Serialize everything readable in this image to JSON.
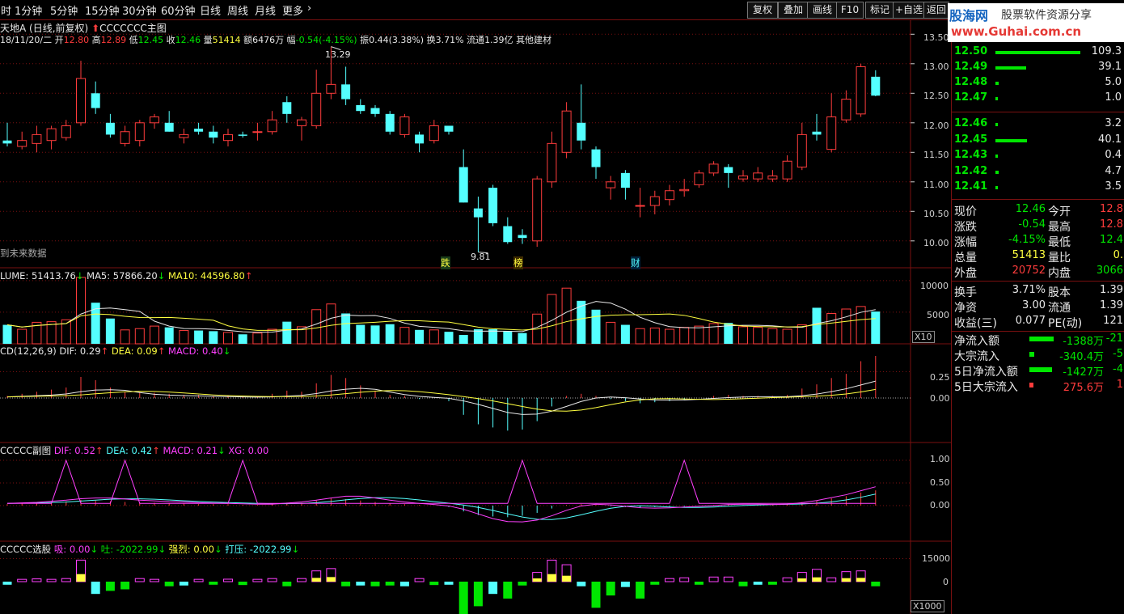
{
  "toolbar": {
    "periods": [
      "时",
      "1分钟",
      "5分钟",
      "15分钟",
      "30分钟",
      "60分钟",
      "日线",
      "周线",
      "月线",
      "更多"
    ],
    "more_arrow": "›",
    "buttons": [
      "复权",
      "叠加",
      "画线",
      "F10",
      "标记",
      "+自选",
      "返回"
    ]
  },
  "logo": {
    "brand": "股海网",
    "slogan": "股票软件资源分享",
    "url": "www.Guhai.com.cn"
  },
  "main": {
    "stock": "天地A",
    "mode": "(日线,前复权)",
    "title": "CCCCCCC主图",
    "date": "18/11/20/二",
    "open_label": "开",
    "open": "12.80",
    "high_label": "高",
    "high": "12.89",
    "low_label": "低",
    "low": "12.45",
    "close_label": "收",
    "close": "12.46",
    "vol_label": "量",
    "vol": "51414",
    "amount_label": "额",
    "amount": "6476万",
    "change_label": "幅",
    "change": "-0.54(-4.15%)",
    "amp_label": "振",
    "amp": "0.44(3.38%)",
    "turn_label": "换",
    "turn": "3.71%",
    "float_label": "流通",
    "float": "1.39亿",
    "sector": "其他建材",
    "future_text": "到未来数据",
    "high_mark": "13.29",
    "low_mark": "9.81",
    "tags": [
      "跌",
      "榜",
      "财"
    ],
    "axis": [
      "13.50",
      "13.00",
      "12.50",
      "12.00",
      "11.50",
      "11.00",
      "10.50",
      "10.00"
    ]
  },
  "volume": {
    "label": "LUME: 51413.76",
    "ma5": "MA5: 57866.20",
    "ma10": "MA10: 44596.80",
    "axis": [
      "10000",
      "5000"
    ],
    "unit": "X10"
  },
  "macd": {
    "label": "CD(12,26,9)",
    "dif": "DIF: 0.29",
    "dea": "DEA: 0.09",
    "macd": "MACD: 0.40",
    "axis": [
      "0.25",
      "0.00"
    ]
  },
  "sub": {
    "label": "CCCCC副图",
    "dif": "DIF: 0.52",
    "dea": "DEA: 0.42",
    "macd": "MACD: 0.21",
    "xg": "XG: 0.00",
    "axis": [
      "1.00",
      "0.50",
      "0.00"
    ]
  },
  "select": {
    "label": "CCCCC选股",
    "xi": "吸: 0.00",
    "tu": "吐: -2022.99",
    "qiang": "强烈: 0.00",
    "daya": "打压: -2022.99",
    "axis": [
      "15000",
      "0"
    ],
    "unit": "X1000"
  },
  "orderbook": {
    "sell": [
      {
        "price": "12.50",
        "vol": "109.3",
        "bar": 100
      },
      {
        "price": "12.49",
        "vol": "39.1",
        "bar": 36
      },
      {
        "price": "12.48",
        "vol": "5.0",
        "bar": 4
      },
      {
        "price": "12.47",
        "vol": "1.0",
        "bar": 2
      }
    ],
    "buy": [
      {
        "price": "12.46",
        "vol": "3.2",
        "bar": 3
      },
      {
        "price": "12.45",
        "vol": "40.1",
        "bar": 37
      },
      {
        "price": "12.43",
        "vol": "0.4",
        "bar": 1
      },
      {
        "price": "12.42",
        "vol": "4.7",
        "bar": 4
      },
      {
        "price": "12.41",
        "vol": "3.5",
        "bar": 3
      }
    ]
  },
  "quote": [
    {
      "k1": "现价",
      "v1": "12.46",
      "c1": "grn",
      "k2": "今开",
      "v2": "12.8",
      "c2": "red"
    },
    {
      "k1": "涨跌",
      "v1": "-0.54",
      "c1": "grn",
      "k2": "最高",
      "v2": "12.8",
      "c2": "red"
    },
    {
      "k1": "涨幅",
      "v1": "-4.15%",
      "c1": "grn",
      "k2": "最低",
      "v2": "12.4",
      "c2": "grn"
    },
    {
      "k1": "总量",
      "v1": "51413",
      "c1": "yel",
      "k2": "量比",
      "v2": "0.",
      "c2": "yel"
    },
    {
      "k1": "外盘",
      "v1": "20752",
      "c1": "red",
      "k2": "内盘",
      "v2": "3066",
      "c2": "grn"
    }
  ],
  "fund": [
    {
      "k1": "换手",
      "v1": "3.71%",
      "k2": "股本",
      "v2": "1.39"
    },
    {
      "k1": "净资",
      "v1": "3.00",
      "k2": "流通",
      "v2": "1.39"
    },
    {
      "k1": "收益(三)",
      "v1": "0.077",
      "k2": "PE(动)",
      "v2": "121"
    }
  ],
  "flow": [
    {
      "k": "净流入额",
      "v": "-1388万",
      "v2": "-21",
      "bar": 30,
      "color": "#00e600",
      "vcolor": "grn"
    },
    {
      "k": "大宗流入",
      "v": "-340.4万",
      "v2": "-5",
      "bar": 6,
      "color": "#00e600",
      "vcolor": "grn"
    },
    {
      "k": "5日净流入额",
      "v": "-1427万",
      "v2": "-4",
      "bar": 28,
      "color": "#00e600",
      "vcolor": "grn"
    },
    {
      "k": "5日大宗流入",
      "v": "275.6万",
      "v2": "1",
      "bar": 5,
      "color": "#ff3c3c",
      "vcolor": "red"
    }
  ],
  "chart_data": {
    "type": "candlestick",
    "ylim": [
      9.6,
      13.6
    ],
    "candles": [
      {
        "o": 11.7,
        "h": 12.0,
        "l": 11.6,
        "c": 11.65
      },
      {
        "o": 11.6,
        "h": 11.85,
        "l": 11.55,
        "c": 11.7
      },
      {
        "o": 11.65,
        "h": 11.95,
        "l": 11.5,
        "c": 11.8
      },
      {
        "o": 11.7,
        "h": 11.95,
        "l": 11.55,
        "c": 11.9
      },
      {
        "o": 11.75,
        "h": 12.05,
        "l": 11.7,
        "c": 11.95
      },
      {
        "o": 12.0,
        "h": 13.05,
        "l": 11.95,
        "c": 12.75
      },
      {
        "o": 12.5,
        "h": 12.7,
        "l": 12.15,
        "c": 12.25
      },
      {
        "o": 12.0,
        "h": 12.15,
        "l": 11.75,
        "c": 11.8
      },
      {
        "o": 11.65,
        "h": 11.95,
        "l": 11.6,
        "c": 11.85
      },
      {
        "o": 11.7,
        "h": 12.05,
        "l": 11.6,
        "c": 12.0
      },
      {
        "o": 12.0,
        "h": 12.15,
        "l": 11.9,
        "c": 12.1
      },
      {
        "o": 12.0,
        "h": 12.2,
        "l": 11.85,
        "c": 11.85
      },
      {
        "o": 11.75,
        "h": 11.9,
        "l": 11.65,
        "c": 11.8
      },
      {
        "o": 11.9,
        "h": 12.0,
        "l": 11.8,
        "c": 11.85
      },
      {
        "o": 11.85,
        "h": 11.95,
        "l": 11.65,
        "c": 11.75
      },
      {
        "o": 11.7,
        "h": 11.9,
        "l": 11.6,
        "c": 11.8
      },
      {
        "o": 11.8,
        "h": 11.85,
        "l": 11.75,
        "c": 11.78
      },
      {
        "o": 11.85,
        "h": 12.0,
        "l": 11.7,
        "c": 11.85
      },
      {
        "o": 11.85,
        "h": 12.2,
        "l": 11.8,
        "c": 12.05
      },
      {
        "o": 12.35,
        "h": 12.45,
        "l": 12.0,
        "c": 12.15
      },
      {
        "o": 11.95,
        "h": 12.1,
        "l": 11.7,
        "c": 12.05
      },
      {
        "o": 11.95,
        "h": 12.9,
        "l": 11.9,
        "c": 12.5
      },
      {
        "o": 12.5,
        "h": 13.29,
        "l": 12.4,
        "c": 12.65
      },
      {
        "o": 12.65,
        "h": 12.95,
        "l": 12.3,
        "c": 12.4
      },
      {
        "o": 12.3,
        "h": 12.4,
        "l": 12.15,
        "c": 12.2
      },
      {
        "o": 12.25,
        "h": 12.3,
        "l": 12.1,
        "c": 12.15
      },
      {
        "o": 12.15,
        "h": 12.2,
        "l": 11.8,
        "c": 11.85
      },
      {
        "o": 11.8,
        "h": 12.15,
        "l": 11.75,
        "c": 12.1
      },
      {
        "o": 11.8,
        "h": 11.85,
        "l": 11.5,
        "c": 11.65
      },
      {
        "o": 11.7,
        "h": 12.05,
        "l": 11.65,
        "c": 11.95
      },
      {
        "o": 11.95,
        "h": 11.95,
        "l": 11.8,
        "c": 11.85
      },
      {
        "o": 11.25,
        "h": 11.55,
        "l": 10.65,
        "c": 10.65
      },
      {
        "o": 10.55,
        "h": 10.75,
        "l": 9.81,
        "c": 10.4
      },
      {
        "o": 10.9,
        "h": 10.95,
        "l": 10.25,
        "c": 10.3
      },
      {
        "o": 10.25,
        "h": 10.4,
        "l": 9.95,
        "c": 9.98
      },
      {
        "o": 10.1,
        "h": 10.2,
        "l": 9.95,
        "c": 10.05
      },
      {
        "o": 10.0,
        "h": 11.1,
        "l": 9.9,
        "c": 11.05
      },
      {
        "o": 11.0,
        "h": 11.85,
        "l": 10.9,
        "c": 11.65
      },
      {
        "o": 11.5,
        "h": 12.35,
        "l": 11.4,
        "c": 12.2
      },
      {
        "o": 12.0,
        "h": 12.65,
        "l": 11.55,
        "c": 11.7
      },
      {
        "o": 11.55,
        "h": 11.6,
        "l": 11.05,
        "c": 11.25
      },
      {
        "o": 10.9,
        "h": 11.1,
        "l": 10.7,
        "c": 11.0
      },
      {
        "o": 11.15,
        "h": 11.2,
        "l": 10.7,
        "c": 10.9
      },
      {
        "o": 10.6,
        "h": 10.9,
        "l": 10.4,
        "c": 10.6
      },
      {
        "o": 10.6,
        "h": 10.85,
        "l": 10.45,
        "c": 10.75
      },
      {
        "o": 10.7,
        "h": 10.95,
        "l": 10.6,
        "c": 10.85
      },
      {
        "o": 10.85,
        "h": 11.05,
        "l": 10.75,
        "c": 10.87
      },
      {
        "o": 10.95,
        "h": 11.2,
        "l": 10.9,
        "c": 11.15
      },
      {
        "o": 11.15,
        "h": 11.35,
        "l": 11.1,
        "c": 11.3
      },
      {
        "o": 11.25,
        "h": 11.3,
        "l": 10.9,
        "c": 11.15
      },
      {
        "o": 11.05,
        "h": 11.2,
        "l": 11.0,
        "c": 11.1
      },
      {
        "o": 11.05,
        "h": 11.25,
        "l": 11.0,
        "c": 11.15
      },
      {
        "o": 11.05,
        "h": 11.2,
        "l": 11.0,
        "c": 11.1
      },
      {
        "o": 11.05,
        "h": 11.45,
        "l": 11.0,
        "c": 11.35
      },
      {
        "o": 11.25,
        "h": 12.0,
        "l": 11.2,
        "c": 11.8
      },
      {
        "o": 11.85,
        "h": 12.15,
        "l": 11.7,
        "c": 11.8
      },
      {
        "o": 11.55,
        "h": 12.5,
        "l": 11.5,
        "c": 12.1
      },
      {
        "o": 12.05,
        "h": 12.55,
        "l": 12.0,
        "c": 12.4
      },
      {
        "o": 12.15,
        "h": 13.0,
        "l": 12.1,
        "c": 12.95
      },
      {
        "o": 12.78,
        "h": 12.89,
        "l": 12.45,
        "c": 12.46
      }
    ],
    "volume": [
      3000,
      2300,
      3400,
      3500,
      3800,
      10500,
      6500,
      4000,
      2200,
      2400,
      2800,
      2600,
      2100,
      2100,
      2000,
      1800,
      1500,
      1700,
      2300,
      3500,
      2700,
      5400,
      6300,
      4800,
      3000,
      2900,
      3100,
      2600,
      2200,
      2200,
      1900,
      1400,
      2300,
      2300,
      2000,
      1700,
      4700,
      7800,
      8800,
      6800,
      5400,
      3400,
      3000,
      2400,
      2500,
      2300,
      2600,
      2800,
      3200,
      3300,
      2700,
      2600,
      2400,
      2300,
      3000,
      5700,
      4800,
      5500,
      5900,
      5100
    ],
    "macd_hist": [
      0.02,
      0.04,
      0.06,
      0.08,
      0.1,
      0.2,
      0.17,
      0.1,
      0.06,
      0.05,
      0.05,
      0.04,
      0.03,
      0.03,
      0.02,
      0.02,
      0.01,
      0.01,
      0.04,
      0.07,
      0.06,
      0.14,
      0.22,
      0.19,
      0.12,
      0.07,
      0.03,
      0.02,
      -0.01,
      0.0,
      -0.03,
      -0.16,
      -0.25,
      -0.28,
      -0.31,
      -0.3,
      -0.22,
      -0.08,
      0.02,
      0.04,
      0.02,
      -0.01,
      -0.03,
      -0.05,
      -0.04,
      -0.03,
      -0.02,
      0.0,
      0.02,
      0.03,
      0.02,
      0.02,
      0.02,
      0.03,
      0.09,
      0.13,
      0.19,
      0.23,
      0.35,
      0.4
    ],
    "sub_macd": [
      0.02,
      0.03,
      0.04,
      0.05,
      0.06,
      0.08,
      0.07,
      0.06,
      0.05,
      0.04,
      0.04,
      0.03,
      0.03,
      0.02,
      0.02,
      0.02,
      0.01,
      0.01,
      0.02,
      0.04,
      0.04,
      0.07,
      0.1,
      0.09,
      0.07,
      0.05,
      0.03,
      0.02,
      0.01,
      0.0,
      -0.02,
      -0.08,
      -0.13,
      -0.15,
      -0.16,
      -0.14,
      -0.1,
      -0.04,
      0.01,
      0.02,
      0.01,
      -0.01,
      -0.02,
      -0.03,
      -0.02,
      -0.01,
      -0.01,
      0.0,
      0.01,
      0.02,
      0.01,
      0.01,
      0.01,
      0.02,
      0.05,
      0.07,
      0.1,
      0.13,
      0.18,
      0.21
    ],
    "select_vals": [
      -2000,
      1500,
      1800,
      1500,
      2000,
      14000,
      -8000,
      -6000,
      -5000,
      2000,
      1500,
      -3000,
      -2500,
      1500,
      -2000,
      1600,
      -2200,
      1500,
      2000,
      -3000,
      2000,
      7000,
      8500,
      -3000,
      -2500,
      -3000,
      -2500,
      -3000,
      2000,
      -2200,
      -2000,
      -26000,
      -16000,
      -8000,
      -11000,
      -2500,
      6000,
      14000,
      11000,
      -3000,
      -17000,
      -9000,
      -3500,
      -11000,
      -2000,
      2000,
      2500,
      -2000,
      3000,
      3000,
      -3000,
      -2000,
      -2000,
      2500,
      6000,
      8000,
      2500,
      6500,
      7000,
      -3000
    ]
  }
}
